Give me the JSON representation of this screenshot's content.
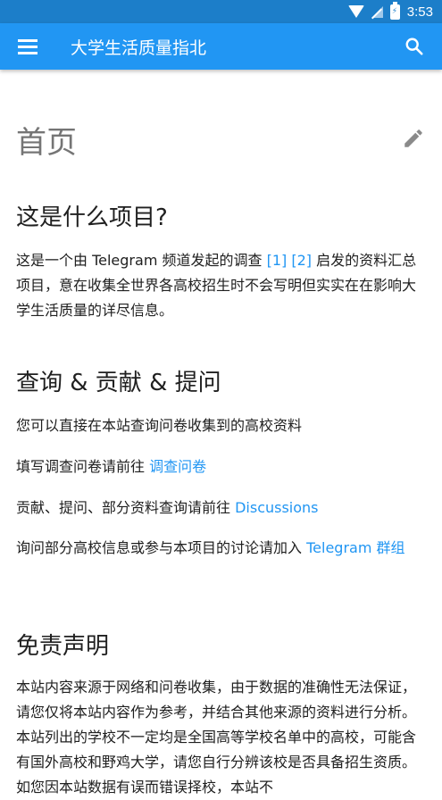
{
  "status": {
    "time": "3:53"
  },
  "appbar": {
    "title": "大学生活质量指北"
  },
  "page": {
    "title": "首页"
  },
  "sections": {
    "about": {
      "heading": "这是什么项目?",
      "text_before": "这是一个由 Telegram 频道发起的调查 ",
      "ref1": "[1]",
      "ref2": "[2]",
      "text_after": " 启发的资料汇总项目，意在收集全世界各高校招生时不会写明但实实在在影响大学生活质量的详尽信息。"
    },
    "query": {
      "heading": "查询 & 贡献 & 提问",
      "line1": "您可以直接在本站查询问卷收集到的高校资料",
      "line2_text": "填写调查问卷请前往 ",
      "line2_link": "调查问卷",
      "line3_text": "贡献、提问、部分资料查询请前往 ",
      "line3_link": "Discussions",
      "line4_text": "询问部分高校信息或参与本项目的讨论请加入 ",
      "line4_link": "Telegram 群组"
    },
    "disclaimer": {
      "heading": "免责声明",
      "text": "本站内容来源于网络和问卷收集，由于数据的准确性无法保证，请您仅将本站内容作为参考，并结合其他来源的资料进行分析。本站列出的学校不一定均是全国高等学校名单中的高校，可能含有国外高校和野鸡大学，请您自行分辨该校是否具备招生资质。如您因本站数据有误而错误择校，本站不"
    }
  },
  "colors": {
    "statusbar": "#1c7ec9",
    "appbar": "#2196f3",
    "link": "#2196f3"
  },
  "icons": [
    "menu-icon",
    "search-icon",
    "edit-icon",
    "wifi-icon",
    "signal-icon",
    "battery-icon"
  ]
}
